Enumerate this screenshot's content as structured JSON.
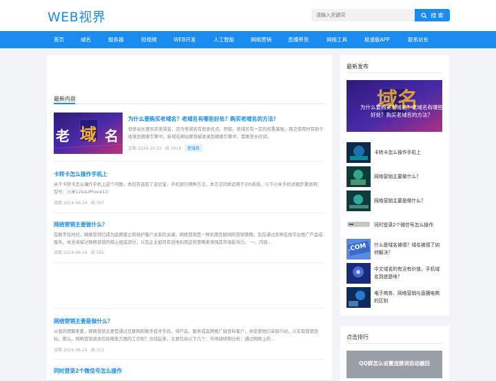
{
  "header": {
    "logo": "WEB视界",
    "search_placeholder": "请输入关键词",
    "search_button": "搜 索"
  },
  "nav": [
    "首页",
    "域名",
    "服务器",
    "短视频",
    "WEB开发",
    "人工智能",
    "网络营销",
    "直播带货",
    "网络工具",
    "极速版APP",
    "联系站长"
  ],
  "main": {
    "section_title": "最新内容",
    "featured_image_text": [
      "老",
      "域",
      "名"
    ],
    "articles": [
      {
        "title": "为什么要购买老域名？老域名有哪些好处？购买老域名的方法？",
        "summary": "很多站长喜欢买老域名。因为老域名有很多优点。例如，老域名有一定的权重基础，再次使用时有助于收录到搜索引擎中。新域名网站要想被收录到搜索引擎中，需要很长时间。",
        "date": "日期 2024-10-25",
        "views": "阅 3918",
        "tag": "老域名"
      },
      {
        "title": "卡转卡怎么操作手机上",
        "summary": "关于卡转卡怎么操作手机上这个问题，本回答选取了支付宝，手机银行两种方法，本方法同样适用于iOS系统，以下小米手机详细步骤说明：型号：小米12&&iPhone13",
        "date": "日期 2024-06-24",
        "views": "阅 307"
      },
      {
        "title": "网络营销主要做什么？",
        "summary": "在数字化时代，网络营销已成为品牌建立和维护客户关系的关键。网络营销是一种利用互联网的营销策略，旨在通过各种在线平台推广产品或服务。本文将探讨网络营销的核心组成部分，以及企业如何有效地利用这些策略来增强其市场影响力。 一、内容...",
        "date": "日期 2024-06-24",
        "views": "阅 595"
      },
      {
        "title": "网络营销主要是做什么？",
        "summary": "从我的理解来看，网络营销主要是通过互联网和数字技术手段，将产品、服务或品牌推广给目标客户，并促使他们采取行动，以实现营销目标。那么，网络营销具体包括哪些方面的工作呢？总结起来，主要包括以下几个：市场调研和分析：通过网络上的...",
        "date": "日期 2024-06-24",
        "views": "阅 373"
      },
      {
        "title": "同时登录2个微信号怎么操作"
      }
    ]
  },
  "sidebar": {
    "latest_title": "最新发布",
    "featured_caption": "为什么要购买老域名？老域名有哪些好处？购买老域名的方法？",
    "featured_image_text": "域名",
    "items": [
      "卡转卡怎么操作手机上",
      "网络营销主要做什么？",
      "网络营销主要是做什么？",
      "同时登录2个微信号怎么操作",
      "什么是域名被墙？域名被墙了如何解决？",
      "中文域名的有没有价值，手机域名到底是啥？",
      "电子商务、网络营销与直播电商的区别"
    ],
    "com_badge": ".COM",
    "hot_title": "点击排行",
    "hot_image_caption": "QQ群怎么设置违禁词自动撤回"
  },
  "colors": {
    "brand": "#1a8cf0",
    "featured_bg": "#3a1f8c",
    "featured_text": "#f6b42c"
  }
}
